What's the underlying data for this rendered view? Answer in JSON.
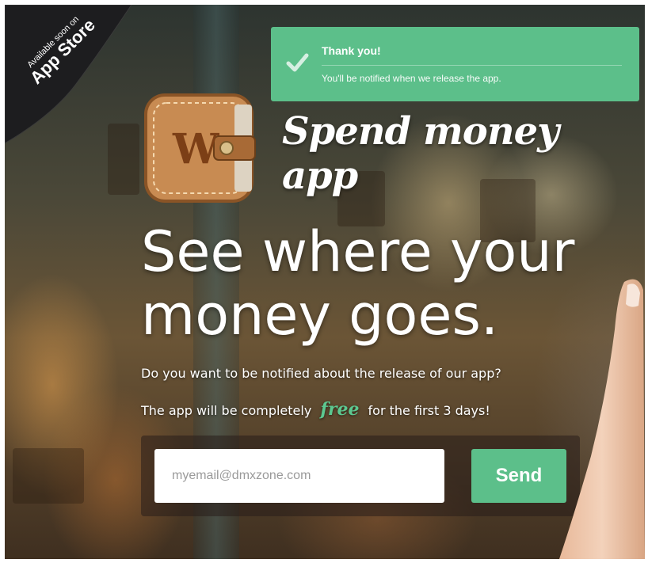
{
  "corner_badge": {
    "line1": "Available soon on",
    "line2": "App Store"
  },
  "notification": {
    "title": "Thank you!",
    "message": "You'll be notified when we release the app.",
    "color": "#5cbf8a"
  },
  "brand": {
    "icon_letter": "W",
    "title": "Spend money app"
  },
  "hero": {
    "headline_line1": "See where your",
    "headline_line2": "money goes.",
    "subtitle1": "Do you want to be notified about the release of our app?",
    "subtitle2_before": "The app will be completely",
    "subtitle2_highlight": "free",
    "subtitle2_after": "for the first 3 days!"
  },
  "form": {
    "email_placeholder": "myemail@dmxzone.com",
    "send_label": "Send"
  },
  "icons": [
    "check-icon",
    "wallet-app-icon"
  ],
  "colors": {
    "accent": "#5cbf8a",
    "free_text": "#5cc890"
  }
}
